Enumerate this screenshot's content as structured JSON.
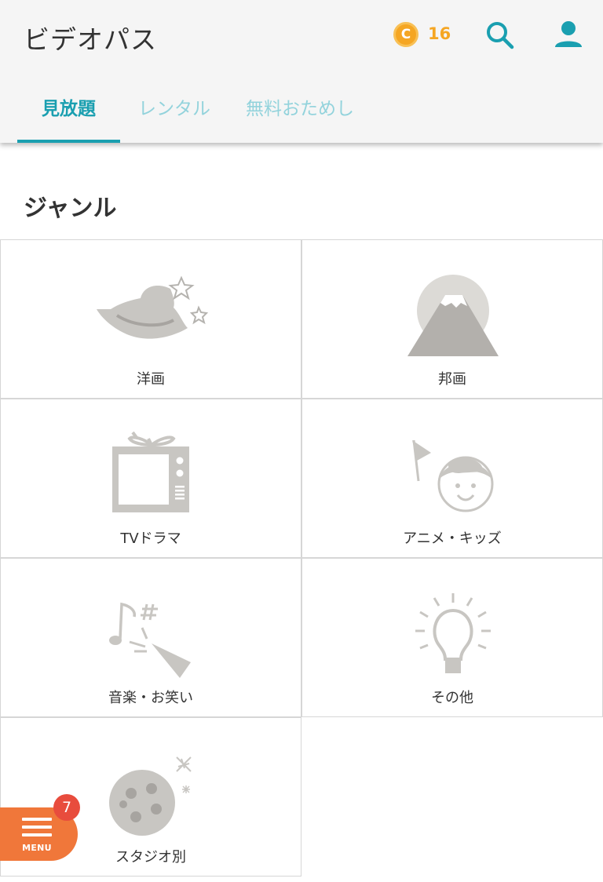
{
  "header": {
    "title": "ビデオパス",
    "coin_symbol": "C",
    "coin_count": "16",
    "search_icon": "search-icon",
    "user_icon": "user-icon"
  },
  "tabs": [
    {
      "label": "見放題",
      "active": true
    },
    {
      "label": "レンタル",
      "active": false
    },
    {
      "label": "無料おためし",
      "active": false
    }
  ],
  "section": {
    "title": "ジャンル"
  },
  "genres": [
    {
      "label": "洋画",
      "icon": "hat-stars-icon"
    },
    {
      "label": "邦画",
      "icon": "mount-fuji-icon"
    },
    {
      "label": "TVドラマ",
      "icon": "tv-icon"
    },
    {
      "label": "アニメ・キッズ",
      "icon": "child-flag-icon"
    },
    {
      "label": "音楽・お笑い",
      "icon": "music-megaphone-icon"
    },
    {
      "label": "その他",
      "icon": "lightbulb-icon"
    },
    {
      "label": "スタジオ別",
      "icon": "film-reel-icon"
    }
  ],
  "menu": {
    "label": "MENU",
    "badge": "7"
  },
  "colors": {
    "accent": "#1a9fb0",
    "accent_light": "#93d3dc",
    "coin": "#f5a623",
    "menu": "#f0773a",
    "badge": "#e84c3d",
    "icon_gray": "#c8c6c2"
  }
}
